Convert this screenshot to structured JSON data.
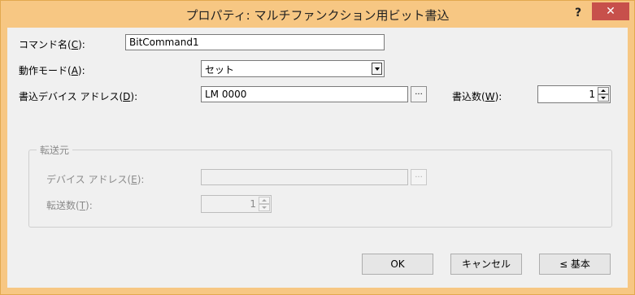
{
  "window": {
    "title": "プロパティ: マルチファンクション用ビット書込",
    "help_label": "?",
    "close_label": "✕"
  },
  "form": {
    "command_name": {
      "label": "コマンド名(",
      "accel": "C",
      "suffix": "):",
      "value": "BitCommand1"
    },
    "operation_mode": {
      "label": "動作モード(",
      "accel": "A",
      "suffix": "):",
      "value": "セット"
    },
    "write_device": {
      "label": "書込デバイス アドレス(",
      "accel": "D",
      "suffix": "):",
      "value": "LM 0000",
      "browse": "..."
    },
    "write_count": {
      "label": "書込数(",
      "accel": "W",
      "suffix": "):",
      "value": "1"
    },
    "transfer_source": {
      "legend": "転送元",
      "device_address": {
        "label": "デバイス アドレス(",
        "accel": "E",
        "suffix": "):",
        "value": "",
        "browse": "..."
      },
      "transfer_count": {
        "label": "転送数(",
        "accel": "T",
        "suffix": "):",
        "value": "1"
      }
    }
  },
  "buttons": {
    "ok": "OK",
    "cancel": "キャンセル",
    "basic": "≤ 基本"
  }
}
